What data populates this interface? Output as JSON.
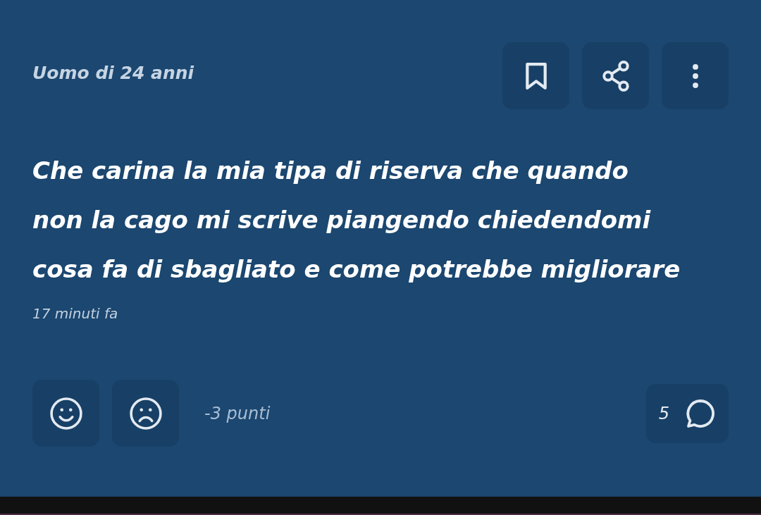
{
  "post": {
    "author": "Uomo di 24 anni",
    "text": "Che carina la mia tipa di riserva che quando non la cago mi scrive piangendo chiedendomi cosa fa di sbagliato e come potrebbe migliorare",
    "time": "17 minuti fa"
  },
  "actions": [
    {
      "kind": "bookmark"
    },
    {
      "kind": "share"
    },
    {
      "kind": "more"
    }
  ],
  "votes": {
    "buttons": [
      {
        "kind": "like"
      },
      {
        "kind": "dislike"
      }
    ],
    "score": "-3 punti"
  },
  "comments": {
    "count": "5"
  }
}
